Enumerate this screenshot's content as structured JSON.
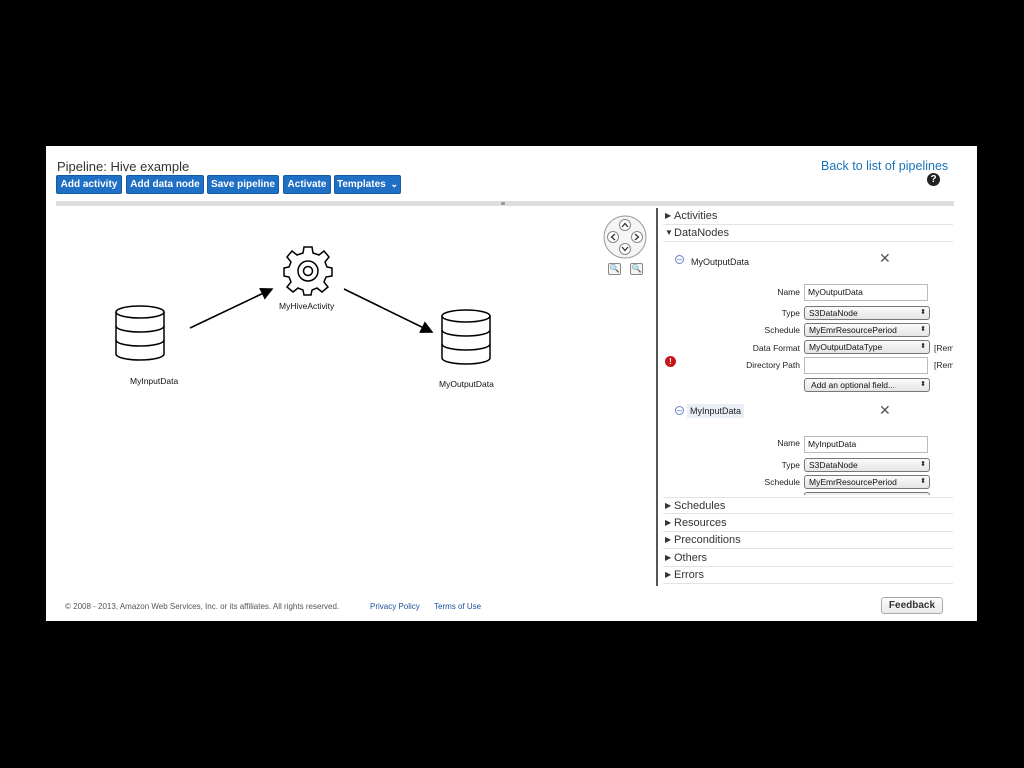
{
  "header": {
    "title": "Pipeline: Hive example",
    "back_link": "Back to list of pipelines",
    "help": "?"
  },
  "toolbar": {
    "add_activity": "Add activity",
    "add_data_node": "Add data node",
    "save_pipeline": "Save pipeline",
    "activate": "Activate",
    "templates": "Templates",
    "templates_caret": "⌄"
  },
  "graph": {
    "activity_node": "MyHiveActivity",
    "input_node": "MyInputData",
    "output_node": "MyOutputData"
  },
  "sidebar": {
    "activities": "Activities",
    "datanodes": "DataNodes",
    "schedules": "Schedules",
    "resources": "Resources",
    "preconditions": "Preconditions",
    "others": "Others",
    "errors": "Errors",
    "output_node": {
      "title": "MyOutputData",
      "name_label": "Name",
      "name_value": "MyOutputData",
      "type_label": "Type",
      "type_value": "S3DataNode",
      "schedule_label": "Schedule",
      "schedule_value": "MyEmrResourcePeriod",
      "format_label": "Data Format",
      "format_value": "MyOutputDataType",
      "remove1": "[Remove]",
      "dirpath_label": "Directory Path",
      "dirpath_value": "",
      "remove2": "[Remove]",
      "optional_field": "Add an optional field..."
    },
    "input_node": {
      "title": "MyInputData",
      "name_label": "Name",
      "name_value": "MyInputData",
      "type_label": "Type",
      "type_value": "S3DataNode",
      "schedule_label": "Schedule",
      "schedule_value": "MyEmrResourcePeriod"
    }
  },
  "footer": {
    "copyright": "© 2008 - 2013, Amazon Web Services, Inc. or its affiliates. All rights reserved.",
    "privacy": "Privacy Policy",
    "terms": "Terms of Use",
    "feedback": "Feedback"
  },
  "colors": {
    "primary_button": "#1f6fc5",
    "link": "#1a73b8",
    "error": "#c7161a"
  }
}
